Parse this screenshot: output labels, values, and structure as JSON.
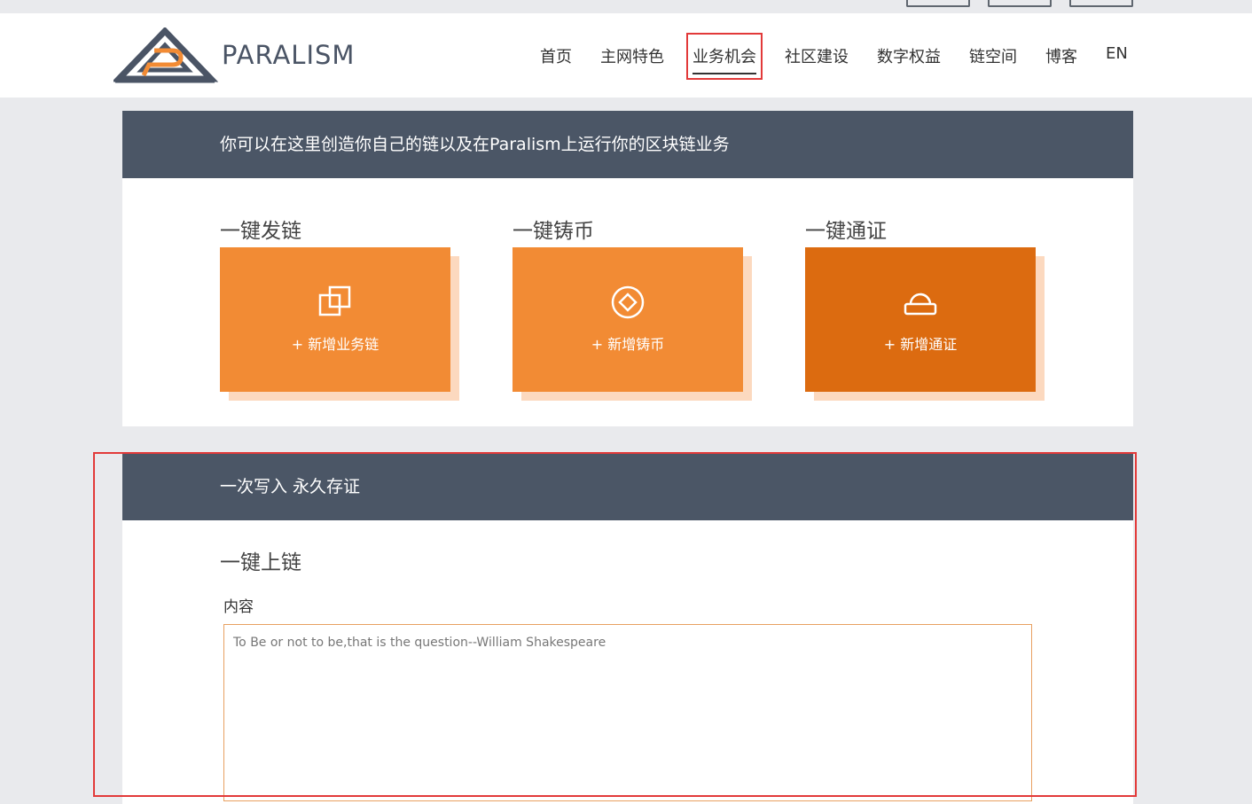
{
  "top_links": [
    "",
    "",
    ""
  ],
  "header": {
    "brand": "PARALISM",
    "nav": [
      {
        "label": "首页",
        "active": false
      },
      {
        "label": "主网特色",
        "active": false
      },
      {
        "label": "业务机会",
        "active": true
      },
      {
        "label": "社区建设",
        "active": false
      },
      {
        "label": "数字权益",
        "active": false
      },
      {
        "label": "链空间",
        "active": false
      },
      {
        "label": "博客",
        "active": false
      },
      {
        "label": "EN",
        "active": false
      }
    ]
  },
  "business": {
    "banner": "你可以在这里创造你自己的链以及在Paralism上运行你的区块链业务",
    "cards": [
      {
        "title": "一键发链",
        "action": "+ 新增业务链",
        "icon": "copy-squares-icon"
      },
      {
        "title": "一键铸币",
        "action": "+ 新增铸币",
        "icon": "coin-diamond-icon"
      },
      {
        "title": "一键通证",
        "action": "+ 新增通证",
        "icon": "token-dome-icon"
      }
    ]
  },
  "onchain": {
    "banner": "一次写入 永久存证",
    "title": "一键上链",
    "content_label": "内容",
    "content_placeholder": "To Be or not to be,that is the question--William Shakespeare"
  },
  "colors": {
    "banner": "#4b5666",
    "card": "#f28b34",
    "card_active": "#dc6b10",
    "card_shadow": "#fcd9bf",
    "highlight": "#e23a3a"
  }
}
